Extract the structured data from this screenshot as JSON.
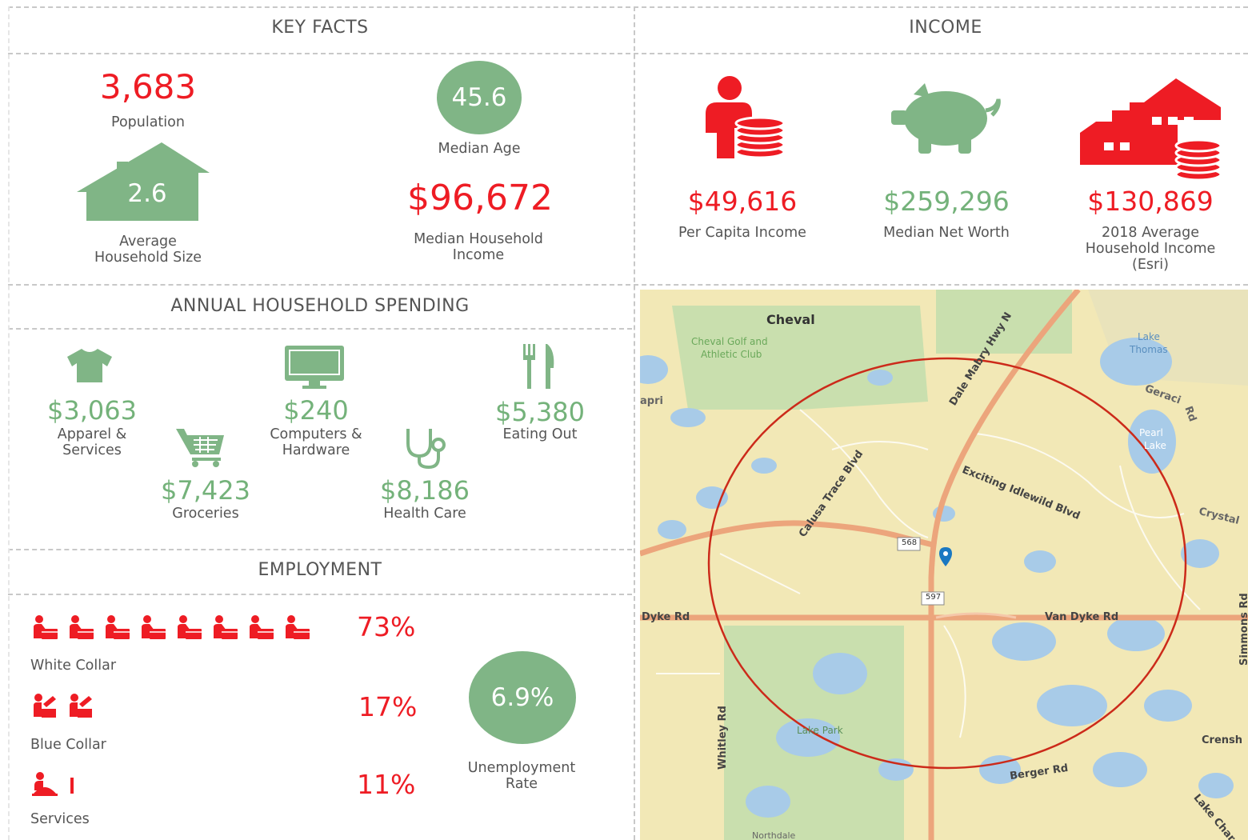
{
  "key_facts": {
    "title": "KEY FACTS",
    "population": {
      "value": "3,683",
      "label": "Population"
    },
    "median_age": {
      "value": "45.6",
      "label": "Median Age"
    },
    "household_size": {
      "value": "2.6",
      "label_line1": "Average",
      "label_line2": "Household Size"
    },
    "median_household_income": {
      "value": "$96,672",
      "label_line1": "Median Household",
      "label_line2": "Income"
    }
  },
  "income": {
    "title": "INCOME",
    "items": [
      {
        "value": "$49,616",
        "label_line1": "Per Capita Income",
        "label_line2": "",
        "label_line3": "",
        "icon": "person-coins-icon"
      },
      {
        "value": "$259,296",
        "label_line1": "Median Net Worth",
        "label_line2": "",
        "label_line3": "",
        "icon": "piggy-bank-icon"
      },
      {
        "value": "$130,869",
        "label_line1": "2018 Average",
        "label_line2": "Household Income",
        "label_line3": "(Esri)",
        "icon": "house-coins-icon"
      }
    ]
  },
  "spending": {
    "title": "ANNUAL HOUSEHOLD SPENDING",
    "items": [
      {
        "value": "$3,063",
        "label_line1": "Apparel &",
        "label_line2": "Services",
        "icon": "shirt-icon"
      },
      {
        "value": "$7,423",
        "label_line1": "Groceries",
        "label_line2": "",
        "icon": "shopping-cart-icon"
      },
      {
        "value": "$240",
        "label_line1": "Computers &",
        "label_line2": "Hardware",
        "icon": "computer-monitor-icon"
      },
      {
        "value": "$8,186",
        "label_line1": "Health Care",
        "label_line2": "",
        "icon": "stethoscope-icon"
      },
      {
        "value": "$5,380",
        "label_line1": "Eating Out",
        "label_line2": "",
        "icon": "fork-knife-icon"
      }
    ]
  },
  "employment": {
    "title": "EMPLOYMENT",
    "rows": [
      {
        "label": "White Collar",
        "percent": "73%",
        "icon_count": 8
      },
      {
        "label": "Blue Collar",
        "percent": "17%",
        "icon_count": 2
      },
      {
        "label": "Services",
        "percent": "11%",
        "icon_count": 1.2
      }
    ],
    "unemployment": {
      "value": "6.9%",
      "label_line1": "Unemployment",
      "label_line2": "Rate"
    }
  },
  "map": {
    "labels": {
      "cheval": "Cheval",
      "cheval_golf": "Cheval Golf and",
      "athletic_club": "Athletic Club",
      "lake_thomas_1": "Lake",
      "lake_thomas_2": "Thomas",
      "geraci": "Geraci",
      "geraci_rd": "Rd",
      "pearl_lake_1": "Pearl",
      "pearl_lake_2": "Lake",
      "crystal": "Crystal",
      "capri": "apri",
      "dale_mabry": "Dale Mabry Hwy N",
      "calusa": "Calusa Trace Blvd",
      "exciting": "Exciting Idlewild Blvd",
      "route_568": "568",
      "route_597": "597",
      "dyke_rd": "Dyke Rd",
      "van_dyke": "Van Dyke Rd",
      "simmons": "Simmons Rd",
      "whitley": "Whitley Rd",
      "lake_park": "Lake Park",
      "berger": "Berger Rd",
      "crensh": "Crensh",
      "lake_char": "Lake Char",
      "northdale": "Northdale"
    },
    "colors": {
      "land": "#f2e8b6",
      "park": "#c9dfae",
      "water": "#a8cbe8",
      "road": "#eca57c",
      "ring": "#cc2a1a",
      "pin": "#1a78c2"
    }
  }
}
